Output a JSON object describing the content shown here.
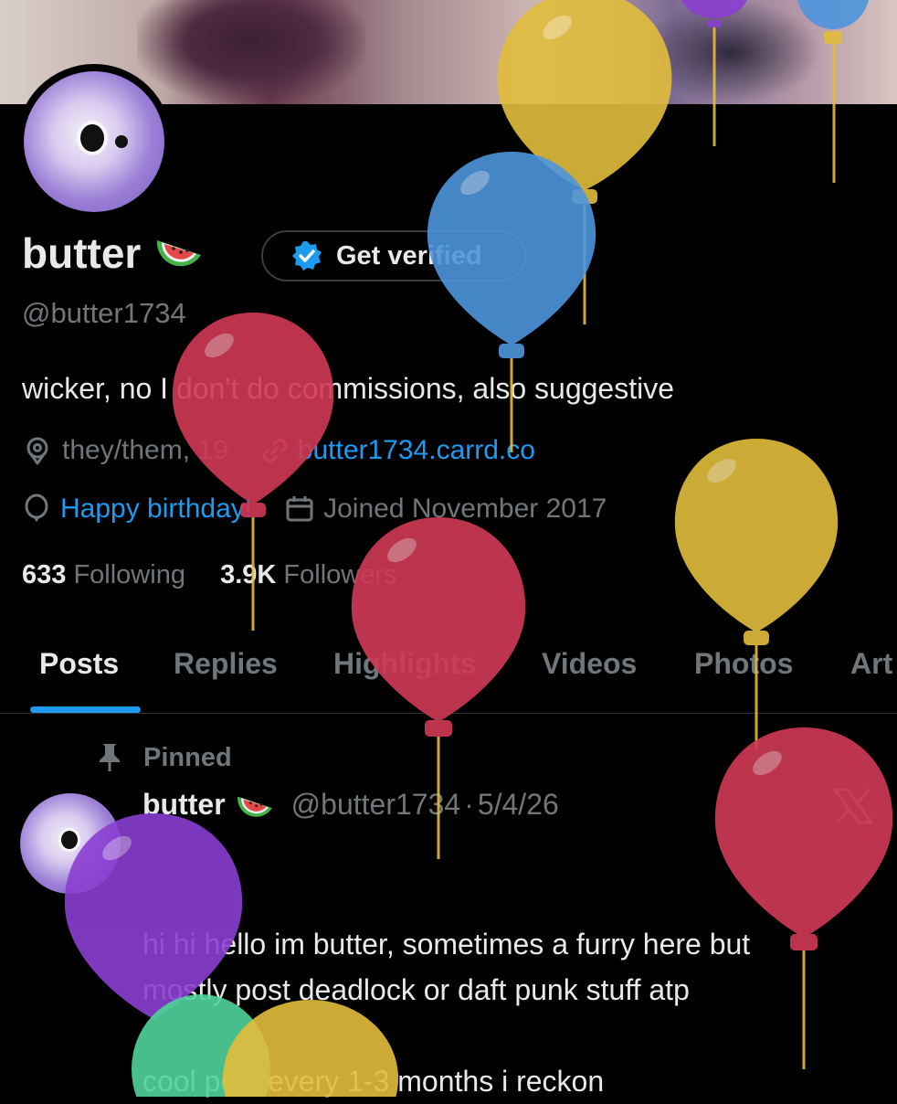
{
  "profile": {
    "name": "butter",
    "name_emoji": "watermelon-emoji",
    "get_verified_label": "Get verified",
    "handle": "@butter1734",
    "bio": "wicker, no I don't do commissions, also suggestive",
    "location": "they/them, 19",
    "website": "butter1734.carrd.co",
    "birthday": "Happy birthday!",
    "joined": "Joined November 2017",
    "following_count": "633",
    "following_label": "Following",
    "followers_count": "3.9K",
    "followers_label": "Followers"
  },
  "tabs": [
    {
      "label": "Posts",
      "active": true
    },
    {
      "label": "Replies",
      "active": false
    },
    {
      "label": "Highlights",
      "active": false
    },
    {
      "label": "Videos",
      "active": false
    },
    {
      "label": "Photos",
      "active": false
    },
    {
      "label": "Art",
      "active": false
    }
  ],
  "post": {
    "pinned_label": "Pinned",
    "author": "butter",
    "handle": "@butter1734",
    "separator": "·",
    "date": "5/4/26",
    "line1": "hi hi hello im butter, sometimes a furry here but",
    "line2": "mostly post deadlock or daft punk stuff atp",
    "line3": "cool post every 1-3 months i reckon"
  },
  "colors": {
    "accent": "#1d9bf0",
    "balloon_yellow": "#e2bd3c",
    "balloon_blue": "#4d95dd",
    "balloon_red": "#d03a55",
    "balloon_purple": "#8a3fd1",
    "balloon_green": "#4fd39a"
  }
}
